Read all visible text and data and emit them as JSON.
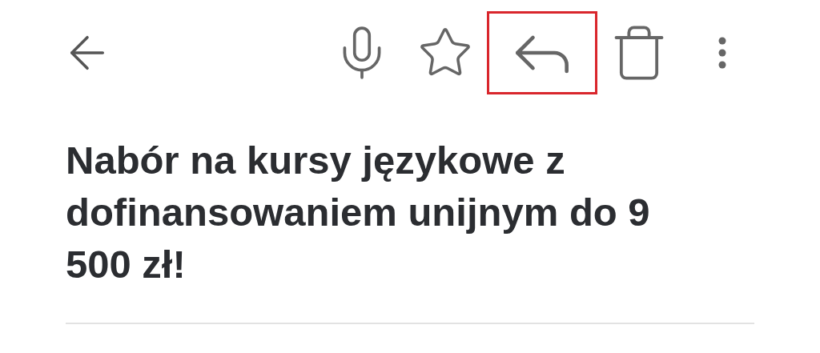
{
  "toolbar": {
    "actions": [
      {
        "kind": "mic",
        "highlighted": false
      },
      {
        "kind": "star",
        "highlighted": false
      },
      {
        "kind": "reply",
        "highlighted": true
      },
      {
        "kind": "trash",
        "highlighted": false
      },
      {
        "kind": "more",
        "highlighted": false
      }
    ]
  },
  "subject": "Nabór na kursy językowe z dofinansowaniem unijnym do 9 500 zł!"
}
